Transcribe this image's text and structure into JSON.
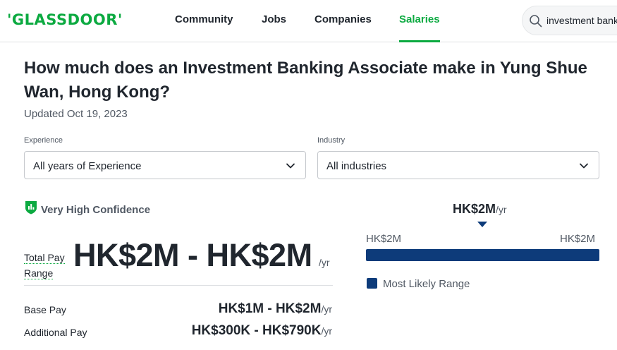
{
  "header": {
    "logo": "'GLASSDOOR'",
    "nav": [
      {
        "label": "Community"
      },
      {
        "label": "Jobs"
      },
      {
        "label": "Companies"
      },
      {
        "label": "Salaries"
      }
    ],
    "active_nav": "Salaries",
    "search": {
      "value": "investment bank",
      "icon": "search-icon"
    },
    "colors": {
      "brand": "#0caa41",
      "text": "#20262e"
    }
  },
  "page": {
    "title": "How much does an Investment Banking Associate make in Yung Shue Wan, Hong Kong?",
    "updated": "Updated Oct 19, 2023"
  },
  "filters": {
    "experience": {
      "label": "Experience",
      "value": "All years of Experience"
    },
    "industry": {
      "label": "Industry",
      "value": "All industries"
    }
  },
  "confidence": {
    "label": "Very High Confidence",
    "icon": "shield-chart-icon"
  },
  "pay": {
    "total": {
      "label": "Total Pay Range",
      "value": "HK$2M - HK$2M",
      "unit": "/yr"
    },
    "rows": [
      {
        "label": "Base Pay",
        "value": "HK$1M - HK$2M",
        "unit": "/yr"
      },
      {
        "label": "Additional Pay",
        "value": "HK$300K - HK$790K",
        "unit": "/yr"
      }
    ]
  },
  "range": {
    "median_value": "HK$2M",
    "median_unit": "/yr",
    "low": "HK$2M",
    "high": "HK$2M",
    "legend": "Most Likely Range",
    "bar_color": "#0d3b7a"
  }
}
